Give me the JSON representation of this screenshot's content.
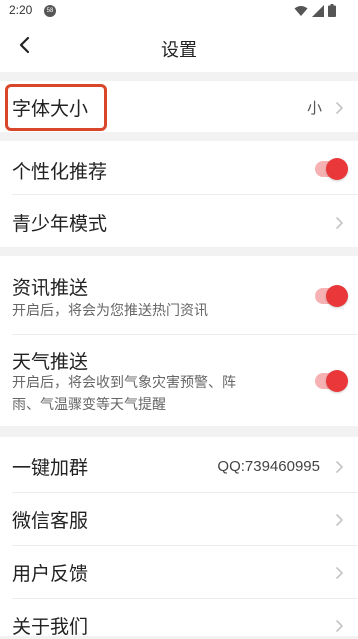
{
  "status_bar": {
    "time": "2:20",
    "notification_badge": "58",
    "icons": [
      "wifi-icon",
      "signal-icon",
      "battery-icon"
    ]
  },
  "nav": {
    "title": "设置",
    "back_icon": "chevron-left-icon"
  },
  "rows": {
    "font_size": {
      "label": "字体大小",
      "value": "小"
    },
    "personalized": {
      "label": "个性化推荐",
      "toggle": true
    },
    "teen_mode": {
      "label": "青少年模式"
    },
    "news_push": {
      "label": "资讯推送",
      "description": "开启后，将会为您推送热门资讯",
      "toggle": true
    },
    "weather_push": {
      "label": "天气推送",
      "description_line1": "开启后，将会收到气象灾害预警、阵",
      "description_line2": "雨、气温骤变等天气提醒",
      "toggle": true
    },
    "join_group": {
      "label": "一键加群",
      "value": "QQ:739460995"
    },
    "wechat_service": {
      "label": "微信客服"
    },
    "feedback": {
      "label": "用户反馈"
    },
    "about": {
      "label": "关于我们"
    }
  },
  "colors": {
    "accent": "#e9373a",
    "toggle_track": "#f6b2b2",
    "highlight": "#d9472b"
  }
}
